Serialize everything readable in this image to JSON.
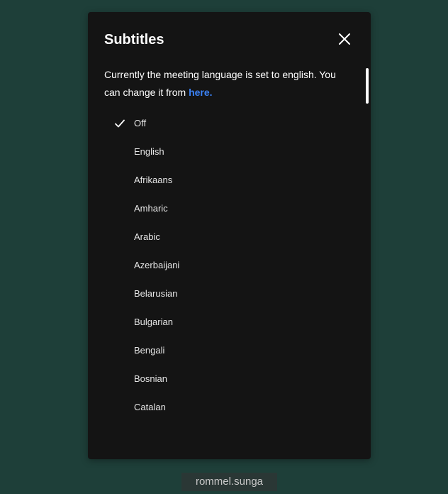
{
  "dialog": {
    "title": "Subtitles",
    "close_icon": "close-icon",
    "info_text": "Currently the meeting language is set to english. You can change it from ",
    "info_link": "here.",
    "link_color": "#3b82f6",
    "selected_icon": "checkmark-icon",
    "languages": [
      {
        "label": "Off",
        "selected": true
      },
      {
        "label": "English",
        "selected": false
      },
      {
        "label": "Afrikaans",
        "selected": false
      },
      {
        "label": "Amharic",
        "selected": false
      },
      {
        "label": "Arabic",
        "selected": false
      },
      {
        "label": "Azerbaijani",
        "selected": false
      },
      {
        "label": "Belarusian",
        "selected": false
      },
      {
        "label": "Bulgarian",
        "selected": false
      },
      {
        "label": "Bengali",
        "selected": false
      },
      {
        "label": "Bosnian",
        "selected": false
      },
      {
        "label": "Catalan",
        "selected": false
      }
    ]
  },
  "participant": {
    "name": "rommel.sunga"
  }
}
